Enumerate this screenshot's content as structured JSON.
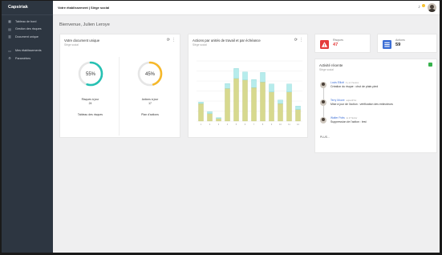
{
  "app": {
    "name": "Capsiriak"
  },
  "sidebar": {
    "items": [
      {
        "label": "Tableau de bord",
        "icon": "dashboard-icon"
      },
      {
        "label": "Gestion des risques",
        "icon": "risk-icon"
      },
      {
        "label": "Document unique",
        "icon": "document-icon"
      },
      {
        "label": "Mes établissements",
        "icon": "building-icon"
      },
      {
        "label": "Paramètres",
        "icon": "gear-icon"
      }
    ]
  },
  "topbar": {
    "breadcrumb": "Votre établissement | Siège social"
  },
  "greeting": "Bienvenue, Julien Leroye",
  "doc_card": {
    "title": "Votre document unique",
    "subtitle": "Siège social",
    "left": {
      "percent": "55%",
      "value": 0.55,
      "label": "Risques à jour",
      "count": "24",
      "button": "Tableau des risques",
      "color": "#26c1b3"
    },
    "right": {
      "percent": "45%",
      "value": 0.45,
      "label": "Actions à jour",
      "count": "17",
      "button": "Plan d'actions",
      "color": "#f6b829"
    }
  },
  "chart_card": {
    "title": "Actions par unités de travail et par échéance",
    "subtitle": "Siège social"
  },
  "chart_data": {
    "type": "bar",
    "categories": [
      "1",
      "2",
      "3",
      "4",
      "5",
      "6",
      "7",
      "8",
      "9",
      "10",
      "11",
      "12"
    ],
    "series": [
      {
        "values": [
          3.5,
          1.5,
          0.5,
          6.5,
          8.5,
          8.2,
          6.7,
          7.8,
          5.8,
          3.5,
          5.8,
          2.3
        ],
        "color": "#d7d98e"
      },
      {
        "values": [
          0.3,
          0.4,
          0.2,
          1.0,
          2.0,
          1.6,
          1.6,
          1.9,
          1.6,
          0.7,
          1.6,
          0.7
        ],
        "color": "#b6ecec"
      }
    ],
    "ylim": [
      0,
      12
    ],
    "stacked": true,
    "grid": true,
    "colors": {
      "primary": "#d7d98e",
      "secondary": "#b6ecec"
    }
  },
  "stats": {
    "risks": {
      "label": "Risques",
      "value": "47",
      "color": "#e53b3b",
      "icon": "warning-icon"
    },
    "actions": {
      "label": "Actions",
      "value": "59",
      "color": "#3d6fd6",
      "icon": "list-icon"
    }
  },
  "activity": {
    "title": "Activité récente",
    "subtitle": "Siège social",
    "items": [
      {
        "who": "Louis Elliott",
        "when": "il y a 2 heures",
        "text": "Création du risque : chut de plain-pied"
      },
      {
        "who": "Terry Moore",
        "when": "aujourd'hui",
        "text": "Mise à jour de l'action : vérification des extincteurs"
      },
      {
        "who": "Walter Potts",
        "when": "le 17 février",
        "text": "Suppression de l'action : test"
      }
    ],
    "more": "PLUS..."
  }
}
